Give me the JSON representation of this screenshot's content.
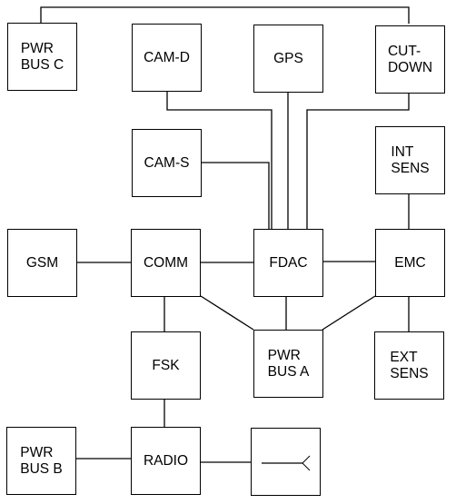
{
  "diagram": {
    "type": "block-diagram",
    "blocks": {
      "pwr_bus_c": {
        "label": "PWR\nBUS C"
      },
      "cam_d": {
        "label": "CAM-D"
      },
      "gps": {
        "label": "GPS"
      },
      "cut_down": {
        "label": "CUT-\nDOWN"
      },
      "cam_s": {
        "label": "CAM-S"
      },
      "int_sens": {
        "label": "INT\nSENS"
      },
      "gsm": {
        "label": "GSM"
      },
      "comm": {
        "label": "COMM"
      },
      "fdac": {
        "label": "FDAC"
      },
      "emc": {
        "label": "EMC"
      },
      "fsk": {
        "label": "FSK"
      },
      "pwr_bus_a": {
        "label": "PWR\nBUS A"
      },
      "ext_sens": {
        "label": "EXT\nSENS"
      },
      "pwr_bus_b": {
        "label": "PWR\nBUS B"
      },
      "radio": {
        "label": "RADIO"
      },
      "antenna": {
        "label": "",
        "icon": "antenna-icon"
      }
    },
    "connections": [
      [
        "pwr_bus_c",
        "cut_down"
      ],
      [
        "cam_d",
        "fdac"
      ],
      [
        "gps",
        "fdac"
      ],
      [
        "cut_down",
        "fdac"
      ],
      [
        "cam_s",
        "fdac"
      ],
      [
        "int_sens",
        "emc"
      ],
      [
        "gsm",
        "comm"
      ],
      [
        "comm",
        "fdac"
      ],
      [
        "fdac",
        "emc"
      ],
      [
        "comm",
        "fsk"
      ],
      [
        "comm",
        "pwr_bus_a"
      ],
      [
        "fdac",
        "pwr_bus_a"
      ],
      [
        "emc",
        "pwr_bus_a"
      ],
      [
        "emc",
        "ext_sens"
      ],
      [
        "fsk",
        "radio"
      ],
      [
        "pwr_bus_b",
        "radio"
      ],
      [
        "radio",
        "antenna"
      ]
    ]
  }
}
